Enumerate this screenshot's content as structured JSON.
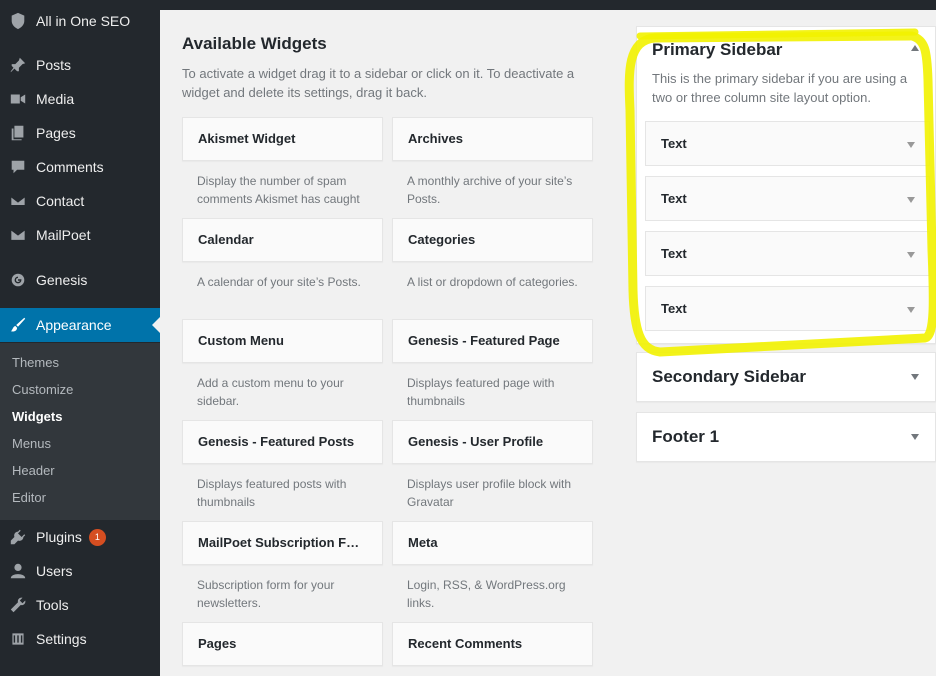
{
  "admin_menu": {
    "top_item": "All in One SEO",
    "items": [
      {
        "label": "Posts",
        "icon": "pin-icon"
      },
      {
        "label": "Media",
        "icon": "media-icon"
      },
      {
        "label": "Pages",
        "icon": "pages-icon"
      },
      {
        "label": "Comments",
        "icon": "comments-icon"
      },
      {
        "label": "Contact",
        "icon": "envelope-icon"
      },
      {
        "label": "MailPoet",
        "icon": "mail-icon"
      },
      {
        "label": "Genesis",
        "icon": "genesis-icon"
      },
      {
        "label": "Appearance",
        "icon": "paintbrush-icon",
        "active": true
      },
      {
        "label": "Plugins",
        "icon": "plugin-icon",
        "badge": "1"
      },
      {
        "label": "Users",
        "icon": "user-icon"
      },
      {
        "label": "Tools",
        "icon": "wrench-icon"
      },
      {
        "label": "Settings",
        "icon": "settings-icon"
      }
    ],
    "appearance_submenu": [
      "Themes",
      "Customize",
      "Widgets",
      "Menus",
      "Header",
      "Editor"
    ],
    "current_submenu": "Widgets"
  },
  "available": {
    "title": "Available Widgets",
    "description": "To activate a widget drag it to a sidebar or click on it. To deactivate a widget and delete its settings, drag it back.",
    "widgets": [
      {
        "name": "Akismet Widget",
        "desc": "Display the number of spam comments Akismet has caught"
      },
      {
        "name": "Archives",
        "desc": "A monthly archive of your site’s Posts."
      },
      {
        "name": "Calendar",
        "desc": "A calendar of your site’s Posts."
      },
      {
        "name": "Categories",
        "desc": "A list or dropdown of categories."
      },
      {
        "name": "Custom Menu",
        "desc": "Add a custom menu to your sidebar."
      },
      {
        "name": "Genesis - Featured Page",
        "desc": "Displays featured page with thumbnails"
      },
      {
        "name": "Genesis - Featured Posts",
        "desc": "Displays featured posts with thumbnails"
      },
      {
        "name": "Genesis - User Profile",
        "desc": "Displays user profile block with Gravatar"
      },
      {
        "name": "MailPoet Subscription Form",
        "desc": "Subscription form for your newsletters."
      },
      {
        "name": "Meta",
        "desc": "Login, RSS, & WordPress.org links."
      },
      {
        "name": "Pages",
        "desc": ""
      },
      {
        "name": "Recent Comments",
        "desc": ""
      }
    ]
  },
  "sidebars": {
    "primary": {
      "title": "Primary Sidebar",
      "description": "This is the primary sidebar if you are using a two or three column site layout option.",
      "widgets": [
        "Text",
        "Text",
        "Text",
        "Text"
      ]
    },
    "secondary": {
      "title": "Secondary Sidebar"
    },
    "footer": {
      "title": "Footer 1"
    }
  },
  "colors": {
    "admin_bg": "#23282d",
    "active_blue": "#0073aa",
    "badge": "#d54e21",
    "highlight": "#f2f200"
  }
}
